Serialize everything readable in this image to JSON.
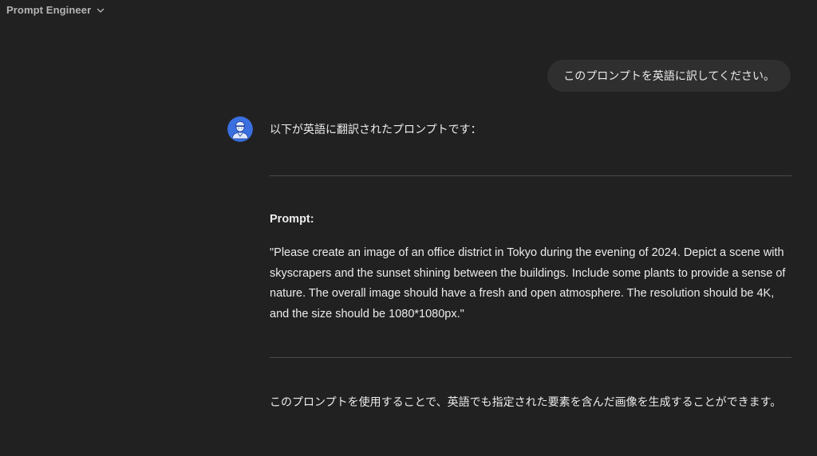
{
  "header": {
    "model_name": "Prompt Engineer",
    "dropdown_icon": "chevron-down-icon"
  },
  "conversation": {
    "user_message": "このプロンプトを英語に訳してください。",
    "assistant": {
      "avatar_icon": "engineer-avatar-icon",
      "avatar_color": "#3a6fe0",
      "intro": "以下が英語に翻訳されたプロンプトです：",
      "prompt_heading": "Prompt:",
      "prompt_text": "\"Please create an image of an office district in Tokyo during the evening of 2024. Depict a scene with skyscrapers and the sunset shining between the buildings. Include some plants to provide a sense of nature. The overall image should have a fresh and open atmosphere. The resolution should be 4K, and the size should be 1080*1080px.\"",
      "closing": "このプロンプトを使用することで、英語でも指定された要素を含んだ画像を生成することができます。"
    }
  },
  "colors": {
    "background": "#212121",
    "user_bubble": "#2f2f2f",
    "text": "#ececec",
    "muted_text": "#b4b4b4",
    "divider": "#4a4a4a"
  }
}
